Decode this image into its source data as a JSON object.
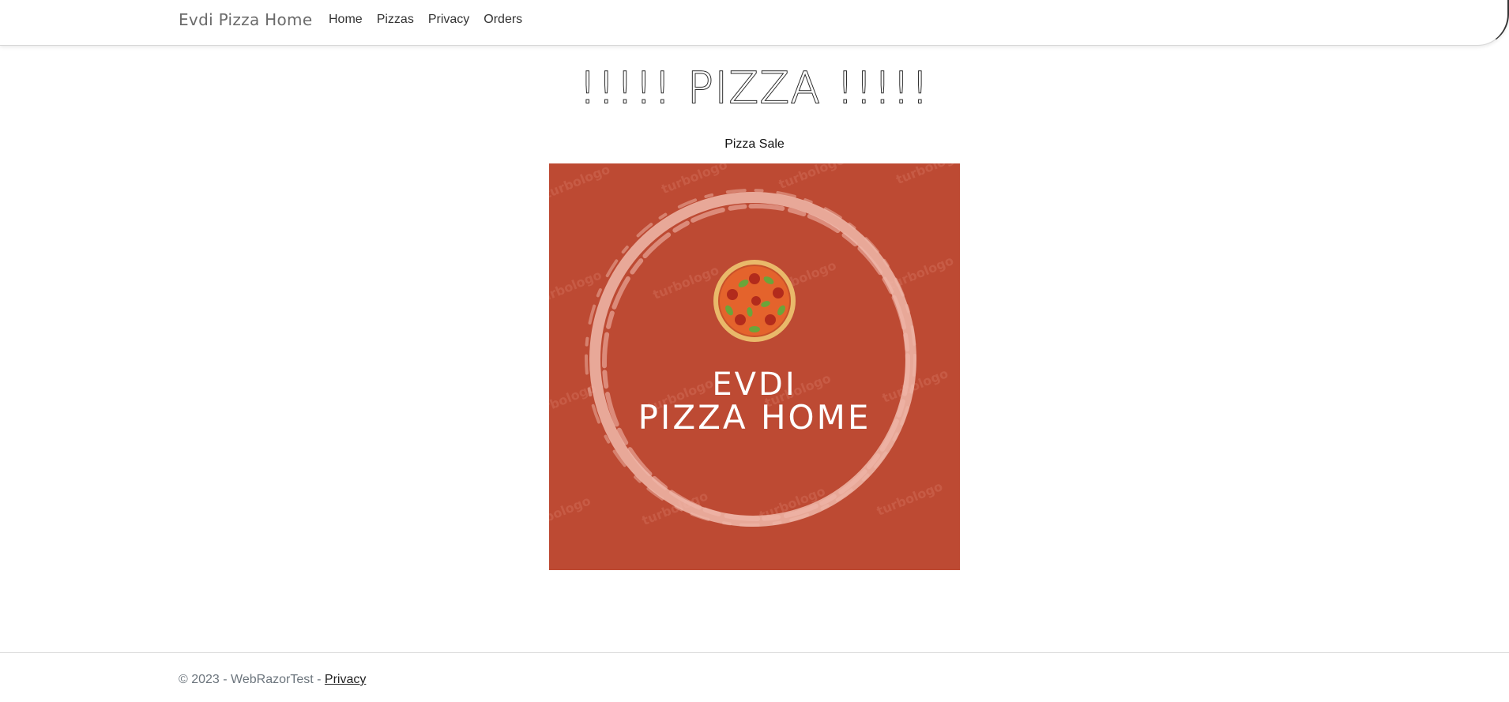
{
  "navbar": {
    "brand": "Evdi Pizza Home",
    "links": [
      "Home",
      "Pizzas",
      "Privacy",
      "Orders"
    ]
  },
  "main": {
    "title": "!!!!! PIZZA !!!!!",
    "subtitle": "Pizza Sale",
    "logo": {
      "line1": "EVDI",
      "line2": "PIZZA HOME",
      "watermark": "turbologo",
      "background_color": "#bd4a33"
    }
  },
  "footer": {
    "copyright": "© 2023 - WebRazorTest - ",
    "privacy_link": "Privacy"
  }
}
